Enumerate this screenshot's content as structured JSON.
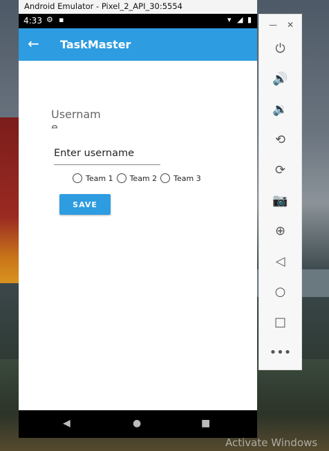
{
  "window": {
    "title": "Android Emulator - Pixel_2_API_30:5554"
  },
  "status_bar": {
    "time": "4:33"
  },
  "app_bar": {
    "title": "TaskMaster"
  },
  "form": {
    "username_label": "Username",
    "username_placeholder": "Enter username",
    "radio_options": [
      "Team 1",
      "Team 2",
      "Team 3"
    ],
    "save_label": "SAVE"
  },
  "colors": {
    "primary": "#2d9ce0"
  },
  "toolbar": {
    "items": [
      "power-icon",
      "volume-up-icon",
      "volume-down-icon",
      "rotate-left-icon",
      "rotate-right-icon",
      "camera-icon",
      "zoom-icon",
      "back-icon",
      "home-icon",
      "overview-icon",
      "more-icon"
    ]
  },
  "watermark": "Activate Windows"
}
